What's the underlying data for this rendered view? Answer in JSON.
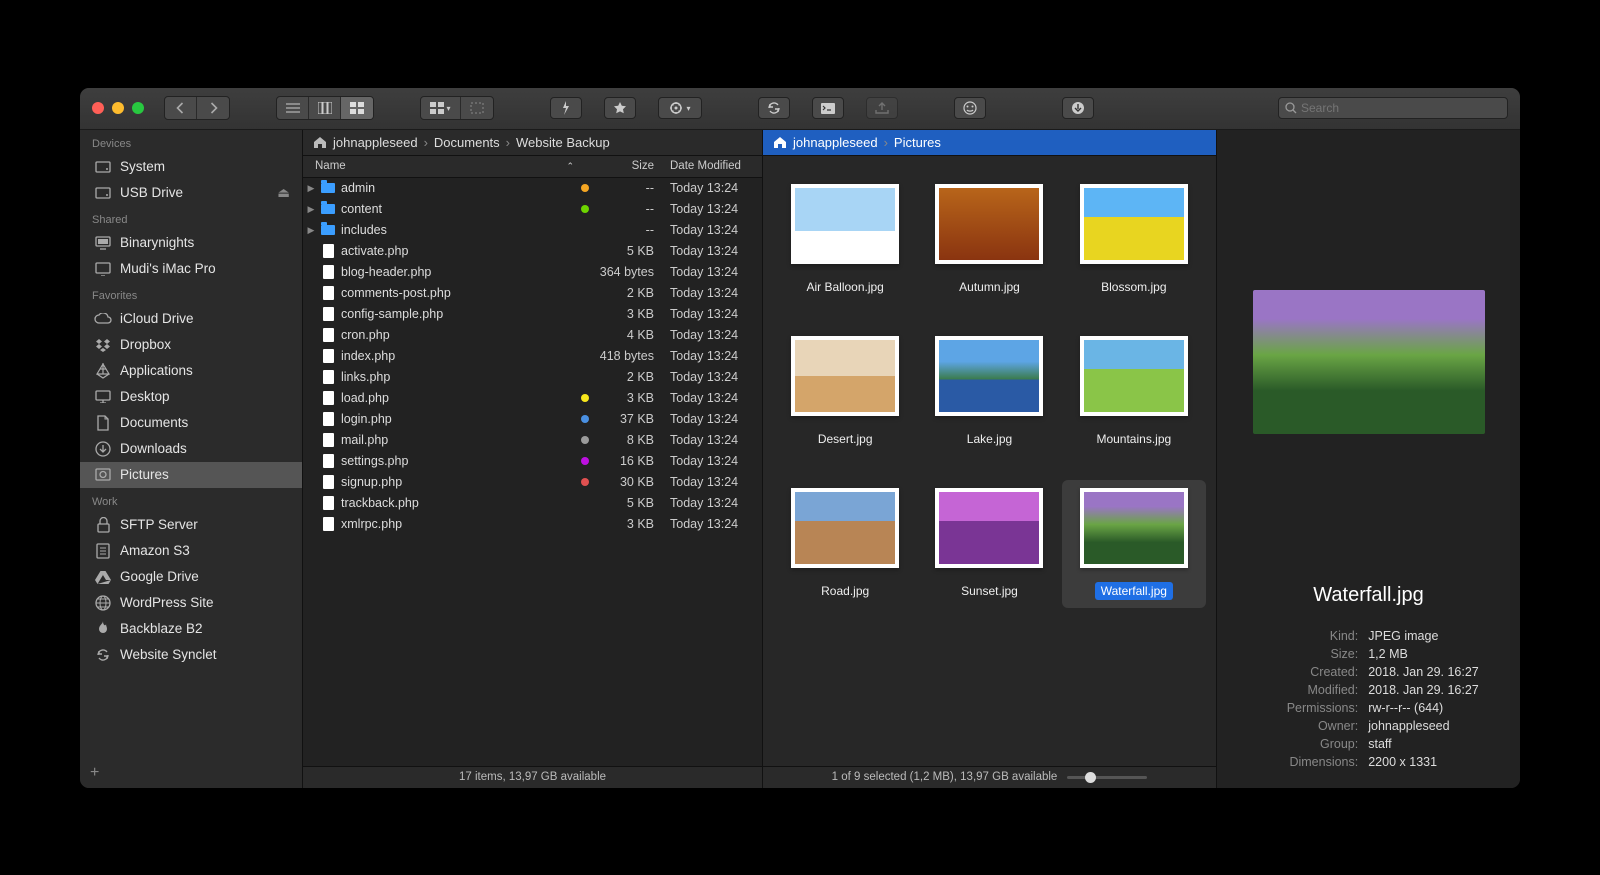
{
  "search_placeholder": "Search",
  "sidebar": {
    "sections": [
      {
        "title": "Devices",
        "items": [
          {
            "label": "System",
            "icon": "hdd"
          },
          {
            "label": "USB Drive",
            "icon": "hdd",
            "eject": true
          }
        ]
      },
      {
        "title": "Shared",
        "items": [
          {
            "label": "Binarynights",
            "icon": "computer"
          },
          {
            "label": "Mudi's iMac Pro",
            "icon": "screen"
          }
        ]
      },
      {
        "title": "Favorites",
        "items": [
          {
            "label": "iCloud Drive",
            "icon": "cloud"
          },
          {
            "label": "Dropbox",
            "icon": "dropbox"
          },
          {
            "label": "Applications",
            "icon": "apps"
          },
          {
            "label": "Desktop",
            "icon": "desktop"
          },
          {
            "label": "Documents",
            "icon": "doc"
          },
          {
            "label": "Downloads",
            "icon": "download"
          },
          {
            "label": "Pictures",
            "icon": "pictures",
            "selected": true
          }
        ]
      },
      {
        "title": "Work",
        "items": [
          {
            "label": "SFTP Server",
            "icon": "lock"
          },
          {
            "label": "Amazon S3",
            "icon": "s3"
          },
          {
            "label": "Google Drive",
            "icon": "gdrive"
          },
          {
            "label": "WordPress Site",
            "icon": "globe"
          },
          {
            "label": "Backblaze B2",
            "icon": "flame"
          },
          {
            "label": "Website Synclet",
            "icon": "sync"
          }
        ]
      }
    ]
  },
  "left": {
    "breadcrumb": [
      "johnappleseed",
      "Documents",
      "Website Backup"
    ],
    "columns": {
      "name": "Name",
      "size": "Size",
      "date": "Date Modified"
    },
    "files": [
      {
        "name": "admin",
        "folder": true,
        "size": "--",
        "date": "Today 13:24",
        "tag": "#f5a623"
      },
      {
        "name": "content",
        "folder": true,
        "size": "--",
        "date": "Today 13:24",
        "tag": "#6dd400"
      },
      {
        "name": "includes",
        "folder": true,
        "size": "--",
        "date": "Today 13:24"
      },
      {
        "name": "activate.php",
        "size": "5 KB",
        "date": "Today 13:24"
      },
      {
        "name": "blog-header.php",
        "size": "364 bytes",
        "date": "Today 13:24"
      },
      {
        "name": "comments-post.php",
        "size": "2 KB",
        "date": "Today 13:24"
      },
      {
        "name": "config-sample.php",
        "size": "3 KB",
        "date": "Today 13:24"
      },
      {
        "name": "cron.php",
        "size": "4 KB",
        "date": "Today 13:24"
      },
      {
        "name": "index.php",
        "size": "418 bytes",
        "date": "Today 13:24"
      },
      {
        "name": "links.php",
        "size": "2 KB",
        "date": "Today 13:24"
      },
      {
        "name": "load.php",
        "size": "3 KB",
        "date": "Today 13:24",
        "tag": "#f8e71c"
      },
      {
        "name": "login.php",
        "size": "37 KB",
        "date": "Today 13:24",
        "tag": "#4a90e2"
      },
      {
        "name": "mail.php",
        "size": "8 KB",
        "date": "Today 13:24",
        "tag": "#9b9b9b"
      },
      {
        "name": "settings.php",
        "size": "16 KB",
        "date": "Today 13:24",
        "tag": "#bd10e0"
      },
      {
        "name": "signup.php",
        "size": "30 KB",
        "date": "Today 13:24",
        "tag": "#e05050"
      },
      {
        "name": "trackback.php",
        "size": "5 KB",
        "date": "Today 13:24"
      },
      {
        "name": "xmlrpc.php",
        "size": "3 KB",
        "date": "Today 13:24"
      }
    ],
    "status": "17 items, 13,97 GB available"
  },
  "mid": {
    "breadcrumb": [
      "johnappleseed",
      "Pictures"
    ],
    "items": [
      {
        "name": "Air Balloon.jpg",
        "cls": "t-balloon"
      },
      {
        "name": "Autumn.jpg",
        "cls": "t-autumn"
      },
      {
        "name": "Blossom.jpg",
        "cls": "t-blossom"
      },
      {
        "name": "Desert.jpg",
        "cls": "t-desert"
      },
      {
        "name": "Lake.jpg",
        "cls": "t-lake"
      },
      {
        "name": "Mountains.jpg",
        "cls": "t-mountains"
      },
      {
        "name": "Road.jpg",
        "cls": "t-road"
      },
      {
        "name": "Sunset.jpg",
        "cls": "t-sunset"
      },
      {
        "name": "Waterfall.jpg",
        "cls": "t-waterfall",
        "selected": true
      }
    ],
    "status": "1 of 9 selected (1,2 MB), 13,97 GB available"
  },
  "preview": {
    "title": "Waterfall.jpg",
    "meta": [
      {
        "label": "Kind:",
        "value": "JPEG image"
      },
      {
        "label": "Size:",
        "value": "1,2 MB"
      },
      {
        "label": "Created:",
        "value": "2018. Jan 29. 16:27"
      },
      {
        "label": "Modified:",
        "value": "2018. Jan 29. 16:27"
      },
      {
        "label": "Permissions:",
        "value": "rw-r--r-- (644)"
      },
      {
        "label": "Owner:",
        "value": "johnappleseed"
      },
      {
        "label": "Group:",
        "value": "staff"
      },
      {
        "label": "Dimensions:",
        "value": "2200 x 1331"
      }
    ]
  }
}
